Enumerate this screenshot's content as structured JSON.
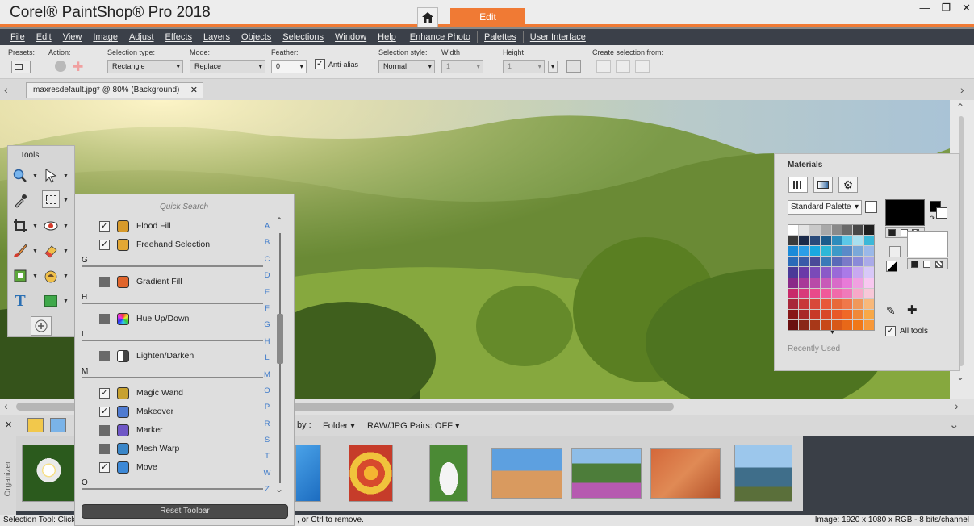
{
  "app": {
    "title": "Corel® PaintShop® Pro 2018",
    "workspace_tab": "Edit"
  },
  "menu": [
    "File",
    "Edit",
    "View",
    "Image",
    "Adjust",
    "Effects",
    "Layers",
    "Objects",
    "Selections",
    "Window",
    "Help",
    "Enhance Photo",
    "Palettes",
    "User Interface"
  ],
  "tool_options": {
    "presets_label": "Presets:",
    "action_label": "Action:",
    "selection_type_label": "Selection type:",
    "selection_type_value": "Rectangle",
    "mode_label": "Mode:",
    "mode_value": "Replace",
    "feather_label": "Feather:",
    "feather_value": "0",
    "antialias_label": "Anti-alias",
    "antialias_checked": true,
    "selection_style_label": "Selection style:",
    "selection_style_value": "Normal",
    "width_label": "Width",
    "width_value": "1",
    "height_label": "Height",
    "height_value": "1",
    "create_from_label": "Create selection from:"
  },
  "document_tab": "maxresdefault.jpg* @  80% (Background)",
  "tools_panel": {
    "title": "Tools"
  },
  "flyout": {
    "search_placeholder": "Quick Search",
    "groups": [
      {
        "kind": "item",
        "label": "Flood Fill",
        "checked": true,
        "icon_color": "#d79a2b"
      },
      {
        "kind": "item",
        "label": "Freehand Selection",
        "checked": true,
        "icon_color": "#e3a734"
      },
      {
        "kind": "header",
        "label": "G"
      },
      {
        "kind": "item",
        "label": "Gradient Fill",
        "checked": false,
        "icon_color": "#e0652c"
      },
      {
        "kind": "header",
        "label": "H"
      },
      {
        "kind": "item",
        "label": "Hue Up/Down",
        "checked": false,
        "icon_color": "#4aa36a"
      },
      {
        "kind": "header",
        "label": "L"
      },
      {
        "kind": "item",
        "label": "Lighten/Darken",
        "checked": false,
        "icon_color": "#9a9a9a"
      },
      {
        "kind": "header",
        "label": "M"
      },
      {
        "kind": "item",
        "label": "Magic Wand",
        "checked": true,
        "icon_color": "#c7a12f"
      },
      {
        "kind": "item",
        "label": "Makeover",
        "checked": true,
        "icon_color": "#4f7bd1"
      },
      {
        "kind": "item",
        "label": "Marker",
        "checked": false,
        "icon_color": "#6f57c6"
      },
      {
        "kind": "item",
        "label": "Mesh Warp",
        "checked": false,
        "icon_color": "#3a86c8"
      },
      {
        "kind": "item",
        "label": "Move",
        "checked": true,
        "icon_color": "#3c88d6"
      },
      {
        "kind": "header",
        "label": "O"
      }
    ],
    "alphabet": [
      "A",
      "B",
      "C",
      "D",
      "E",
      "F",
      "G",
      "H",
      "L",
      "M",
      "O",
      "P",
      "R",
      "S",
      "T",
      "W",
      "Z"
    ],
    "reset_label": "Reset Toolbar"
  },
  "materials": {
    "title": "Materials",
    "palette_select": "Standard Palette",
    "all_tools_label": "All tools",
    "all_tools_checked": true,
    "recently_used_label": "Recently Used",
    "foreground_color": "#000000",
    "background_color": "#ffffff"
  },
  "organizer": {
    "side_label": "Organizer",
    "sort_label": "by :",
    "sort_value": "Folder",
    "pairs_label": "RAW/JPG Pairs: OFF"
  },
  "status": {
    "left": "Selection Tool: Click",
    "middle": ", or Ctrl to remove.",
    "right": "Image:  1920 x 1080 x RGB - 8 bits/channel"
  }
}
